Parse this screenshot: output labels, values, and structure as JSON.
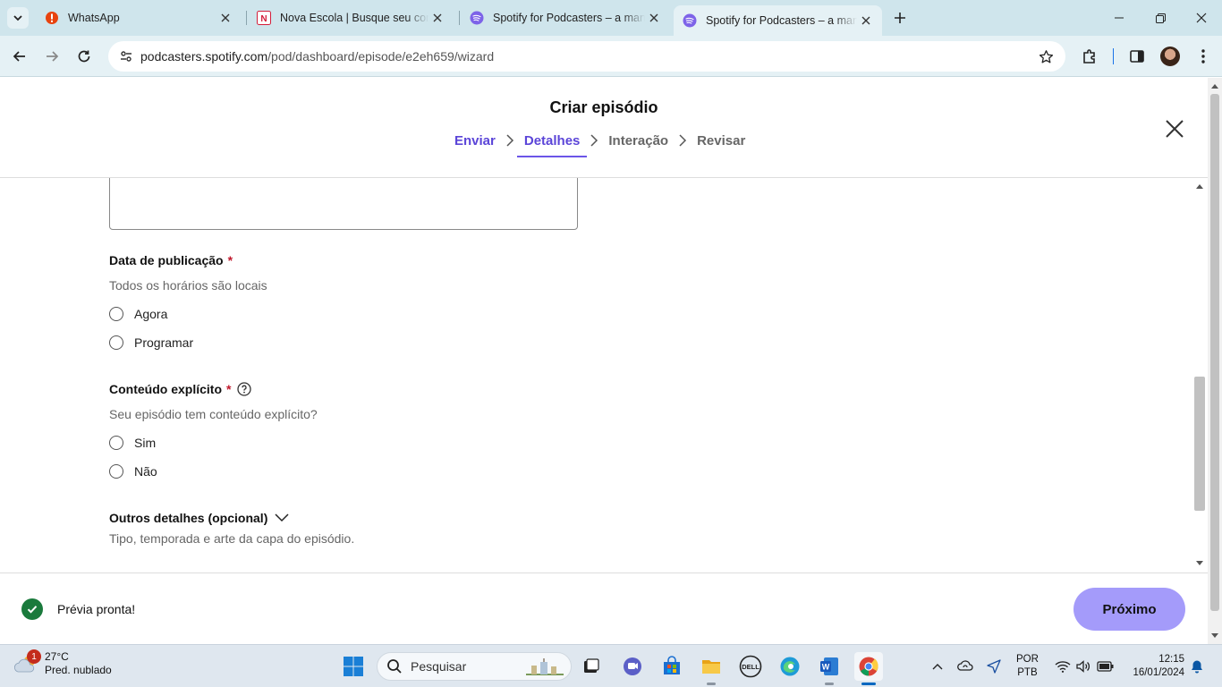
{
  "browser": {
    "tabs": [
      {
        "title": "WhatsApp",
        "icon": "whatsapp-alert-icon"
      },
      {
        "title": "Nova Escola | Busque seu conte",
        "icon": "nova-escola-icon"
      },
      {
        "title": "Spotify for Podcasters – a mane",
        "icon": "spotify-icon"
      },
      {
        "title": "Spotify for Podcasters – a mane",
        "icon": "spotify-icon",
        "active": true
      }
    ],
    "url_domain": "podcasters.spotify.com",
    "url_path": "/pod/dashboard/episode/e2eh659/wizard"
  },
  "header": {
    "title": "Criar episódio",
    "steps": [
      "Enviar",
      "Detalhes",
      "Interação",
      "Revisar"
    ],
    "current_step": "Detalhes"
  },
  "form": {
    "publish_date": {
      "label": "Data de publicação",
      "required_mark": "*",
      "help": "Todos os horários são locais",
      "options": [
        "Agora",
        "Programar"
      ]
    },
    "explicit": {
      "label": "Conteúdo explícito",
      "required_mark": "*",
      "help": "Seu episódio tem conteúdo explícito?",
      "options": [
        "Sim",
        "Não"
      ]
    },
    "other": {
      "label": "Outros detalhes (opcional)",
      "help": "Tipo, temporada e arte da capa do episódio."
    }
  },
  "footer": {
    "status": "Prévia pronta!",
    "next_label": "Próximo"
  },
  "taskbar": {
    "weather_temp": "27°C",
    "weather_desc": "Pred. nublado",
    "weather_badge": "1",
    "search_placeholder": "Pesquisar",
    "lang_1": "POR",
    "lang_2": "PTB",
    "time": "12:15",
    "date": "16/01/2024"
  },
  "colors": {
    "accent": "#5b45d8",
    "next_button": "#a49bfa",
    "tabstrip": "#cfe5ec",
    "success": "#1a7a3c",
    "required": "#c0172b"
  }
}
